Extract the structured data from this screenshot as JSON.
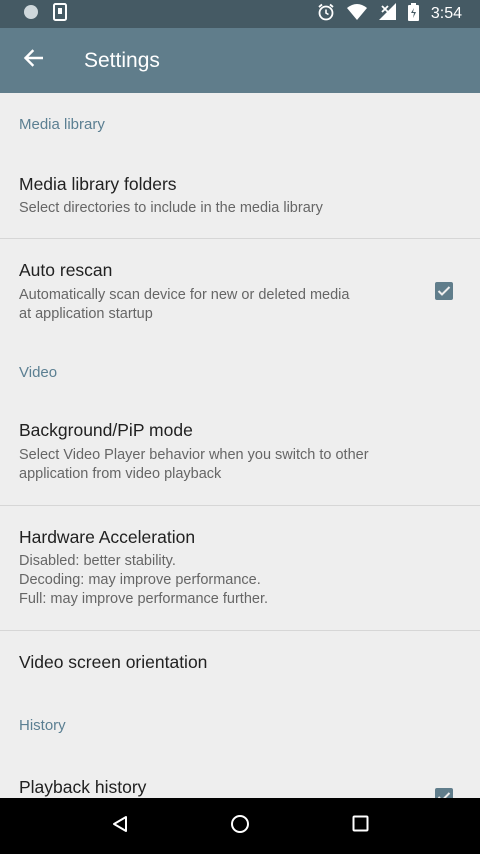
{
  "status_bar": {
    "time": "3:54",
    "icons": [
      "circle-notification-icon",
      "sim-notification-icon",
      "alarm-icon",
      "wifi-icon",
      "signal-icon",
      "battery-icon"
    ]
  },
  "app_bar": {
    "title": "Settings",
    "back_icon": "arrow-back-icon"
  },
  "sections": {
    "media": {
      "header": "Media library",
      "folders_title": "Media library folders",
      "folders_summary": "Select directories to include in the media library",
      "autoscan_title": "Auto rescan",
      "autoscan_summary_1": "Automatically scan device for new or deleted media",
      "autoscan_summary_2": "at application startup",
      "autoscan_checked": true
    },
    "video": {
      "header": "Video",
      "pip_title": "Background/PiP mode",
      "pip_summary_1": "Select Video Player behavior when you switch to other",
      "pip_summary_2": "application from video playback",
      "hw_title": "Hardware Acceleration",
      "hw_summary_1": "Disabled: better stability.",
      "hw_summary_2": "Decoding: may improve performance.",
      "hw_summary_3": "Full: may improve performance further.",
      "orientation_title": "Video screen orientation"
    },
    "history": {
      "header": "History",
      "playback_title": "Playback history",
      "playback_checked": true
    }
  },
  "colors": {
    "status_bar": "#455a64",
    "app_bar": "#607d8b",
    "accent": "#607d8b",
    "category_text": "#5b7f92"
  },
  "nav_bar": {
    "icons": [
      "back-triangle-icon",
      "home-circle-icon",
      "recents-square-icon"
    ]
  }
}
